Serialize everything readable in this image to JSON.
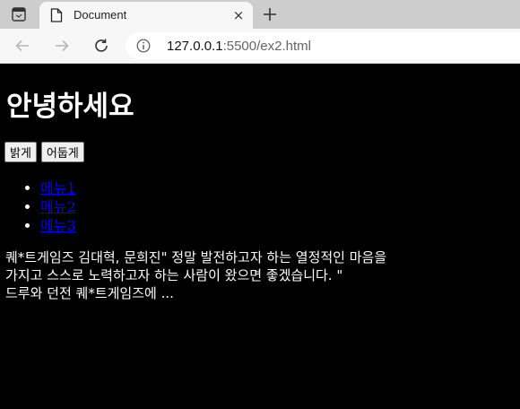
{
  "browser": {
    "tab_title": "Document",
    "close_glyph": "×",
    "url_host": "127.0.0.1",
    "url_rest": ":5500/ex2.html"
  },
  "page": {
    "heading": "안녕하세요",
    "buttons": {
      "light": "밝게",
      "dark": "어둡게"
    },
    "menu": [
      {
        "label": "메뉴1"
      },
      {
        "label": "메뉴2"
      },
      {
        "label": "메뉴3"
      }
    ],
    "paragraph": [
      "퀘*트게임즈 김대혁, 문희진\" 정말 발전하고자 하는 열정적인 마음을",
      "가지고 스스로 노력하고자 하는 사람이 왔으면 좋겠습니다. \"",
      "드루와 던전 퀘*트게임즈에 ..."
    ]
  },
  "colors": {
    "page_background": "#000000",
    "page_text": "#ffffff",
    "link": "#0000ee"
  }
}
